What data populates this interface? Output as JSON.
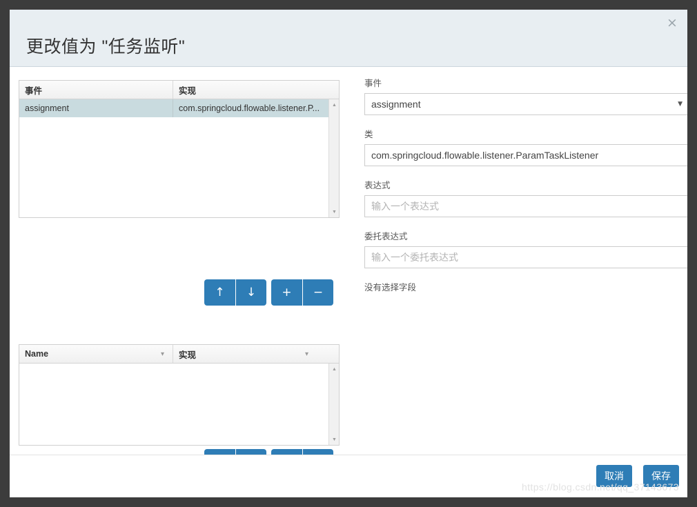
{
  "dialog": {
    "title": "更改值为 \"任务监听\"",
    "close_icon": "×"
  },
  "listener_grid": {
    "columns": [
      {
        "label": "事件",
        "has_chevron": false
      },
      {
        "label": "实现",
        "has_chevron": false
      }
    ],
    "rows": [
      {
        "event": "assignment",
        "implementation": "com.springcloud.flowable.listener.P...",
        "selected": true
      }
    ],
    "scroll_up_icon": "▲",
    "scroll_down_icon": "▼"
  },
  "listener_toolbar": {
    "buttons": [
      {
        "name": "move-up",
        "glyph": "↑"
      },
      {
        "name": "move-down",
        "glyph": "↓"
      },
      {
        "name": "add",
        "glyph": "+"
      },
      {
        "name": "remove",
        "glyph": "−"
      }
    ]
  },
  "fields_grid": {
    "columns": [
      {
        "label": "Name",
        "has_chevron": true
      },
      {
        "label": "实现",
        "has_chevron": true
      }
    ],
    "rows": [],
    "scroll_up_icon": "▲",
    "scroll_down_icon": "▼"
  },
  "fields_toolbar": {
    "buttons": [
      {
        "name": "move-up",
        "glyph": "↑"
      },
      {
        "name": "move-down",
        "glyph": "↓"
      },
      {
        "name": "add",
        "glyph": "+"
      },
      {
        "name": "remove",
        "glyph": "−"
      }
    ]
  },
  "form": {
    "event": {
      "label": "事件",
      "value": "assignment",
      "arrow_icon": "▼",
      "options": [
        "assignment"
      ]
    },
    "class": {
      "label": "类",
      "value": "com.springcloud.flowable.listener.ParamTaskListener",
      "placeholder": ""
    },
    "expression": {
      "label": "表达式",
      "value": "",
      "placeholder": "输入一个表达式"
    },
    "delegate_expression": {
      "label": "委托表达式",
      "value": "",
      "placeholder": "输入一个委托表达式"
    },
    "no_field_selected": "没有选择字段"
  },
  "footer": {
    "cancel_label": "取消",
    "save_label": "保存"
  },
  "watermark": "https://blog.csdn.net/qq_37143673",
  "colors": {
    "accent": "#2e7db6",
    "header_bg": "#e8eef2",
    "row_selected": "#c9dbdf"
  }
}
